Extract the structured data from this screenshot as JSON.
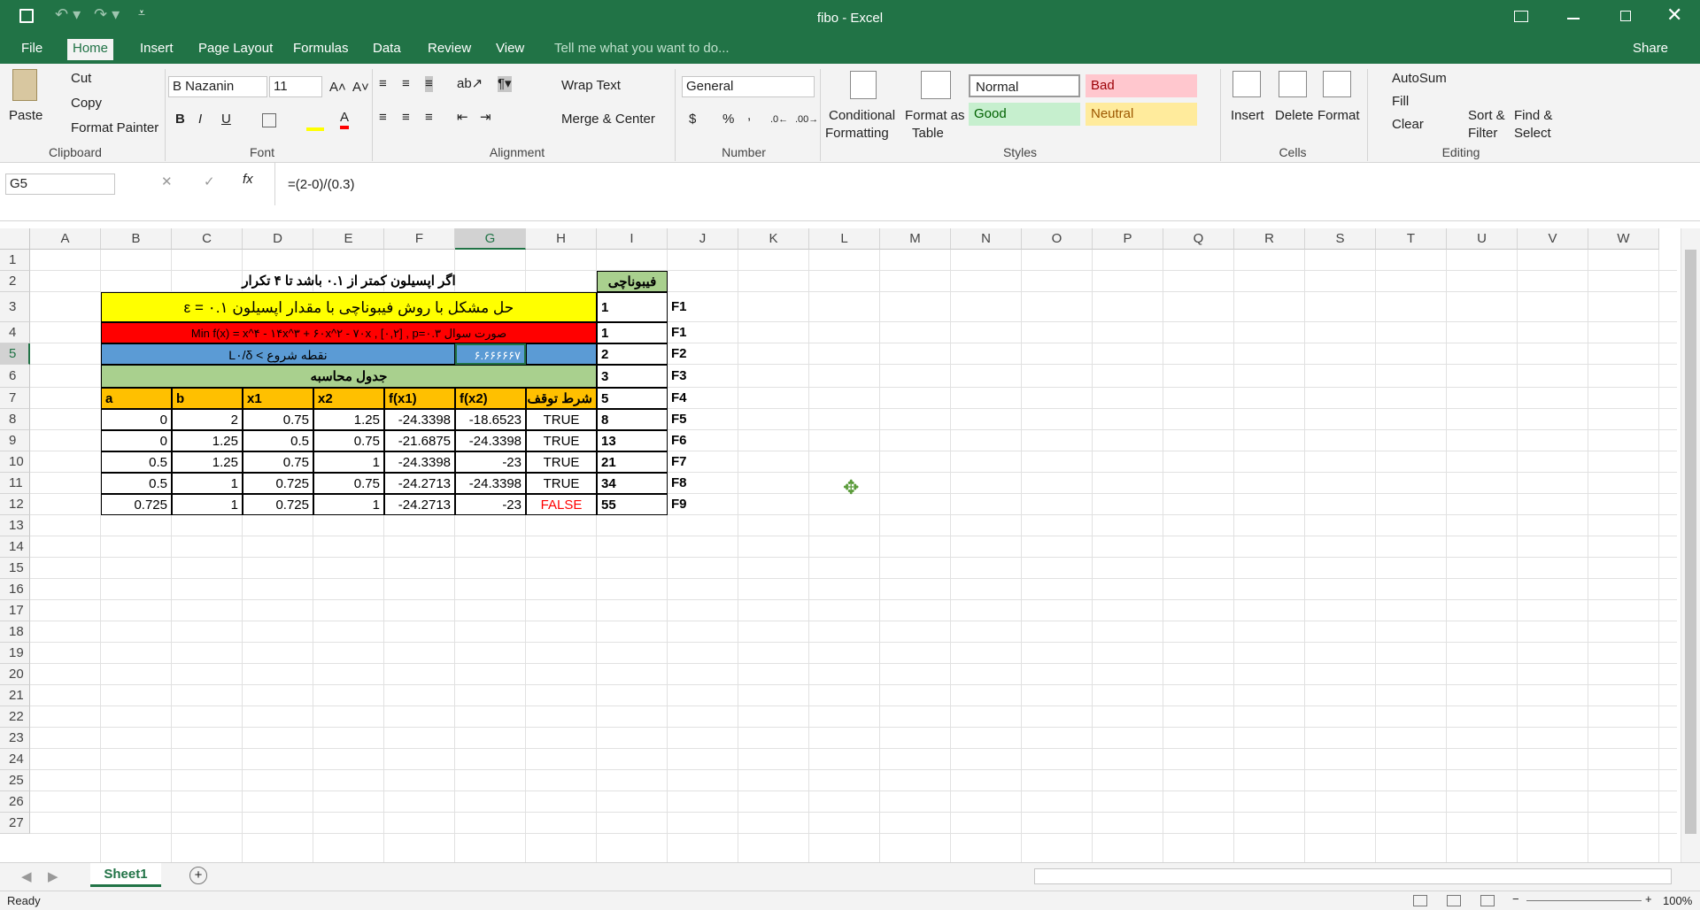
{
  "window": {
    "title": "fibo - Excel",
    "share_label": "Share"
  },
  "tabs": [
    "File",
    "Home",
    "Insert",
    "Page Layout",
    "Formulas",
    "Data",
    "Review",
    "View"
  ],
  "tell_me": "Tell me what you want to do...",
  "clipboard": {
    "paste": "Paste",
    "cut": "Cut",
    "copy": "Copy",
    "format_painter": "Format Painter",
    "group": "Clipboard"
  },
  "font": {
    "name": "B Nazanin",
    "size": "11",
    "bold": "B",
    "italic": "I",
    "underline": "U",
    "group": "Font"
  },
  "alignment": {
    "wrap": "Wrap Text",
    "merge": "Merge & Center",
    "group": "Alignment"
  },
  "number": {
    "format": "General",
    "currency": "$",
    "percent": "%",
    "comma": ",",
    "group": "Number"
  },
  "styles": {
    "conditional1": "Conditional",
    "conditional2": "Formatting",
    "format_table1": "Format as",
    "format_table2": "Table",
    "normal": "Normal",
    "bad": "Bad",
    "good": "Good",
    "neutral": "Neutral",
    "group": "Styles"
  },
  "cells_group": {
    "insert": "Insert",
    "delete": "Delete",
    "format": "Format",
    "group": "Cells"
  },
  "editing": {
    "autosum": "AutoSum",
    "fill": "Fill",
    "clear": "Clear",
    "sort1": "Sort &",
    "sort2": "Filter",
    "find1": "Find &",
    "find2": "Select",
    "group": "Editing"
  },
  "formula_bar": {
    "name_box": "G5",
    "fx": "fx",
    "formula": "=(2-0)/(0.3)"
  },
  "columns": [
    "A",
    "B",
    "C",
    "D",
    "E",
    "F",
    "G",
    "H",
    "I",
    "J",
    "K",
    "L",
    "M",
    "N",
    "O",
    "P",
    "Q",
    "R",
    "S",
    "T",
    "U",
    "V",
    "W"
  ],
  "rows": [
    "1",
    "2",
    "3",
    "4",
    "5",
    "6",
    "7",
    "8",
    "9",
    "10",
    "11",
    "12",
    "13",
    "14",
    "15",
    "16",
    "17",
    "18",
    "19",
    "20",
    "21",
    "22",
    "23",
    "24",
    "25",
    "26",
    "27"
  ],
  "sheet": {
    "r2_title": "اگر اپسیلون کمتر از ۰.۱ باشد تا ۴ تکرار",
    "r2_fib": "فیبوناچی",
    "r3_text": "حل مشکل با روش فیبوناچی با مقدار اپسیلون  ۰.۱ = ε",
    "r4_text": "صورت سوال  Min f(x) = x^۴ - ۱۴x^۳ + ۶۰x^۲ - ۷۰x , [۰,۲] , p=۰.۳",
    "r5_text": "نقطه شروع > L۰/δ",
    "r5_value": "۶.۶۶۶۶۶۷",
    "r6_text": "جدول محاسبه",
    "headers": [
      "a",
      "b",
      "x1",
      "x2",
      "f(x1)",
      "f(x2)",
      "شرط توقف"
    ],
    "data_rows": [
      [
        "0",
        "2",
        "0.75",
        "1.25",
        "-24.3398",
        "-18.6523",
        "TRUE"
      ],
      [
        "0",
        "1.25",
        "0.5",
        "0.75",
        "-21.6875",
        "-24.3398",
        "TRUE"
      ],
      [
        "0.5",
        "1.25",
        "0.75",
        "1",
        "-24.3398",
        "-23",
        "TRUE"
      ],
      [
        "0.5",
        "1",
        "0.725",
        "0.75",
        "-24.2713",
        "-24.3398",
        "TRUE"
      ],
      [
        "0.725",
        "1",
        "0.725",
        "1",
        "-24.2713",
        "-23",
        "FALSE"
      ]
    ],
    "fib_values": [
      "1",
      "1",
      "2",
      "3",
      "5",
      "8",
      "13",
      "21",
      "34",
      "55"
    ],
    "fib_labels": [
      "F1",
      "F1",
      "F2",
      "F3",
      "F4",
      "F5",
      "F6",
      "F7",
      "F8",
      "F9"
    ]
  },
  "sheet_tab": "Sheet1",
  "status": {
    "ready": "Ready",
    "zoom": "100%"
  },
  "colors": {
    "excel_green": "#217346",
    "yellow": "#ffff00",
    "red": "#ff0000",
    "blue": "#5b9bd5",
    "green": "#a9d08e",
    "orange": "#ffc000"
  }
}
